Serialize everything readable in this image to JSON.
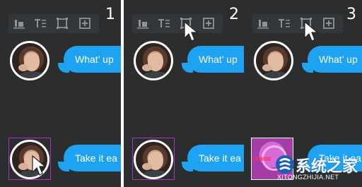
{
  "panels": [
    {
      "step": "1",
      "msg_top": "What’ up",
      "msg_bottom": "Take it ea"
    },
    {
      "step": "2",
      "msg_top": "What’ up",
      "msg_bottom": "Take it ea"
    },
    {
      "step": "3",
      "msg_top": "What’ up",
      "msg_bottom": "Take it ea"
    }
  ],
  "toolbar_icons": [
    "align-bottom-icon",
    "text-format-icon",
    "crop-frame-icon",
    "add-image-icon"
  ],
  "image_label": "roxox",
  "watermark": {
    "title": "系统之家",
    "url": "XITONGZHIJIA.NET"
  },
  "colors": {
    "panel_bg": "#2b2d2f",
    "bubble": "#1da3f2",
    "selection": "#b22ec8"
  }
}
